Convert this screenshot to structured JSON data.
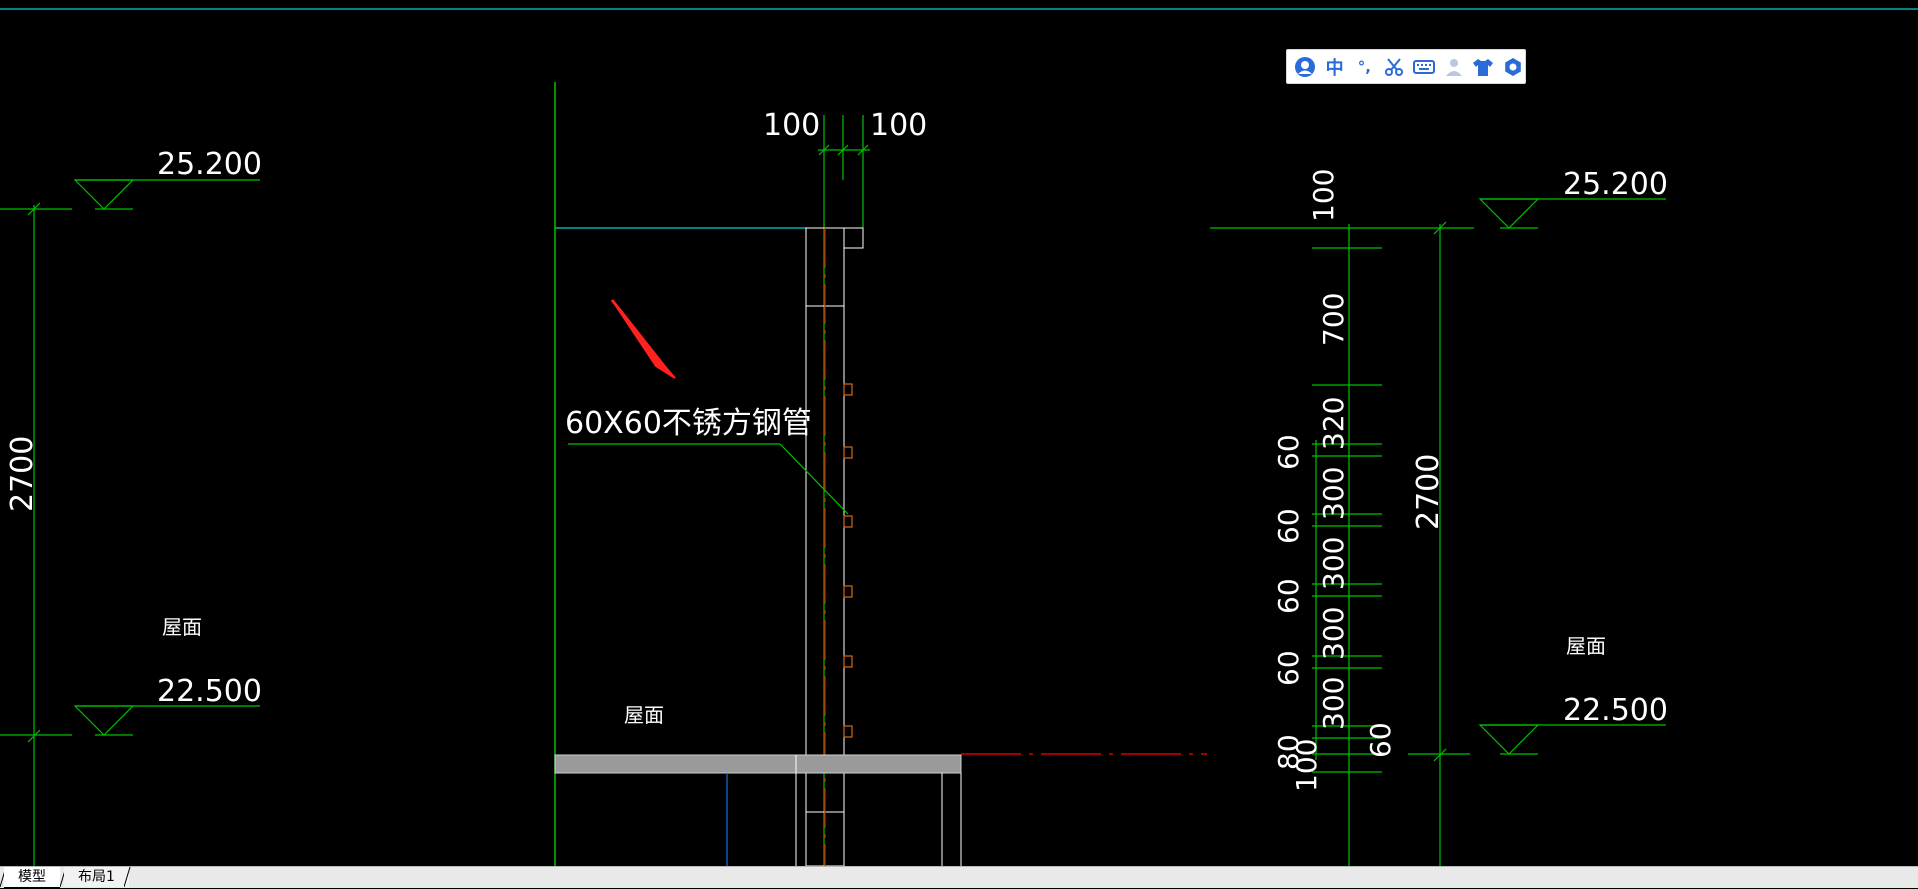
{
  "drawing": {
    "left_section": {
      "level_top": "25.200",
      "level_bottom": "22.500",
      "height_dim": "2700",
      "roof_label": "屋面"
    },
    "middle_section": {
      "dim_left": "100",
      "dim_right": "100",
      "annotation": "60X60不锈方钢管",
      "roof_label": "屋面"
    },
    "right_section": {
      "level_top": "25.200",
      "level_bottom": "22.500",
      "total_dim": "2700",
      "roof_label": "屋面",
      "inner_dims": [
        "100",
        "700",
        "320",
        "300",
        "300",
        "300",
        "300",
        "60",
        "100"
      ],
      "side_dims": [
        "60",
        "60",
        "60",
        "60",
        "80"
      ]
    }
  },
  "ime_toolbar": {
    "items": [
      {
        "name": "ime-avatar-icon",
        "label": ""
      },
      {
        "name": "ime-chinese-button",
        "label": "中"
      },
      {
        "name": "ime-punctuation-button",
        "label": "°,"
      },
      {
        "name": "ime-scissors-icon",
        "label": ""
      },
      {
        "name": "ime-keyboard-icon",
        "label": ""
      },
      {
        "name": "ime-user-icon",
        "label": ""
      },
      {
        "name": "ime-skin-icon",
        "label": ""
      },
      {
        "name": "ime-settings-icon",
        "label": ""
      }
    ]
  },
  "tabs": {
    "model": "模型",
    "layout1": "布局1"
  },
  "colors": {
    "background": "#000000",
    "dimension_green": "#00c000",
    "outline_white": "#ffffff",
    "centerline_red": "#ff0000",
    "cyan": "#00b0b0",
    "arrow_red": "#ff2020",
    "ime_blue": "#2a6bd8"
  }
}
